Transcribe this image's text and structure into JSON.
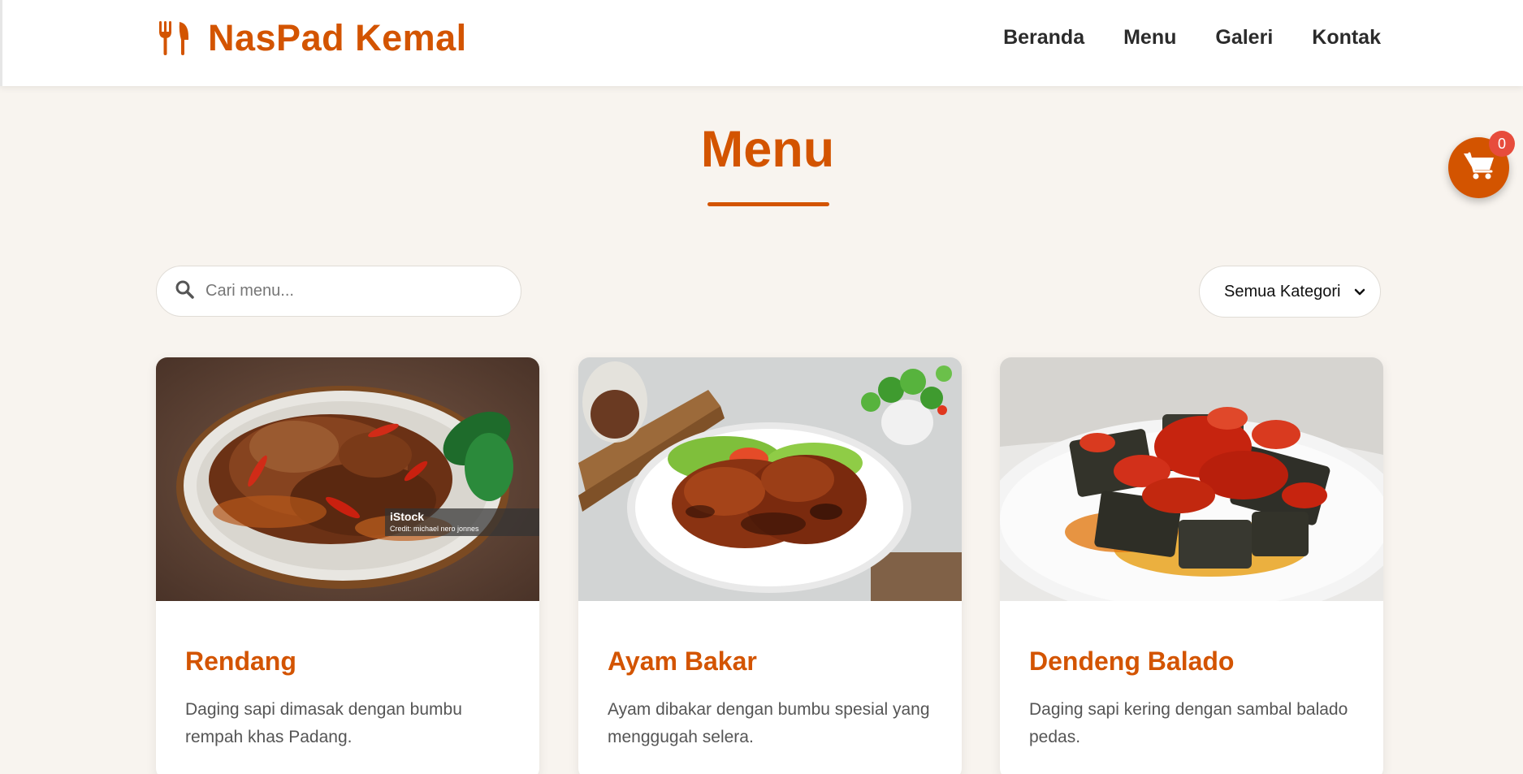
{
  "brand": {
    "name": "NasPad Kemal",
    "icon": "utensils-icon",
    "color": "#d35400"
  },
  "nav": {
    "links": [
      {
        "label": "Beranda"
      },
      {
        "label": "Menu"
      },
      {
        "label": "Galeri"
      },
      {
        "label": "Kontak"
      }
    ]
  },
  "cart": {
    "icon": "cart-icon",
    "count": "0"
  },
  "section": {
    "title": "Menu"
  },
  "search": {
    "icon": "search-icon",
    "placeholder": "Cari menu...",
    "value": ""
  },
  "category_filter": {
    "selected": "Semua Kategori",
    "icon": "chevron-down-icon"
  },
  "menu_items": [
    {
      "name": "Rendang",
      "description": "Daging sapi dimasak dengan bumbu rempah khas Padang.",
      "watermark": "iStock",
      "credit": "Credit: michael nero jonnes"
    },
    {
      "name": "Ayam Bakar",
      "description": "Ayam dibakar dengan bumbu spesial yang menggugah selera."
    },
    {
      "name": "Dendeng Balado",
      "description": "Daging sapi kering dengan sambal balado pedas."
    }
  ]
}
